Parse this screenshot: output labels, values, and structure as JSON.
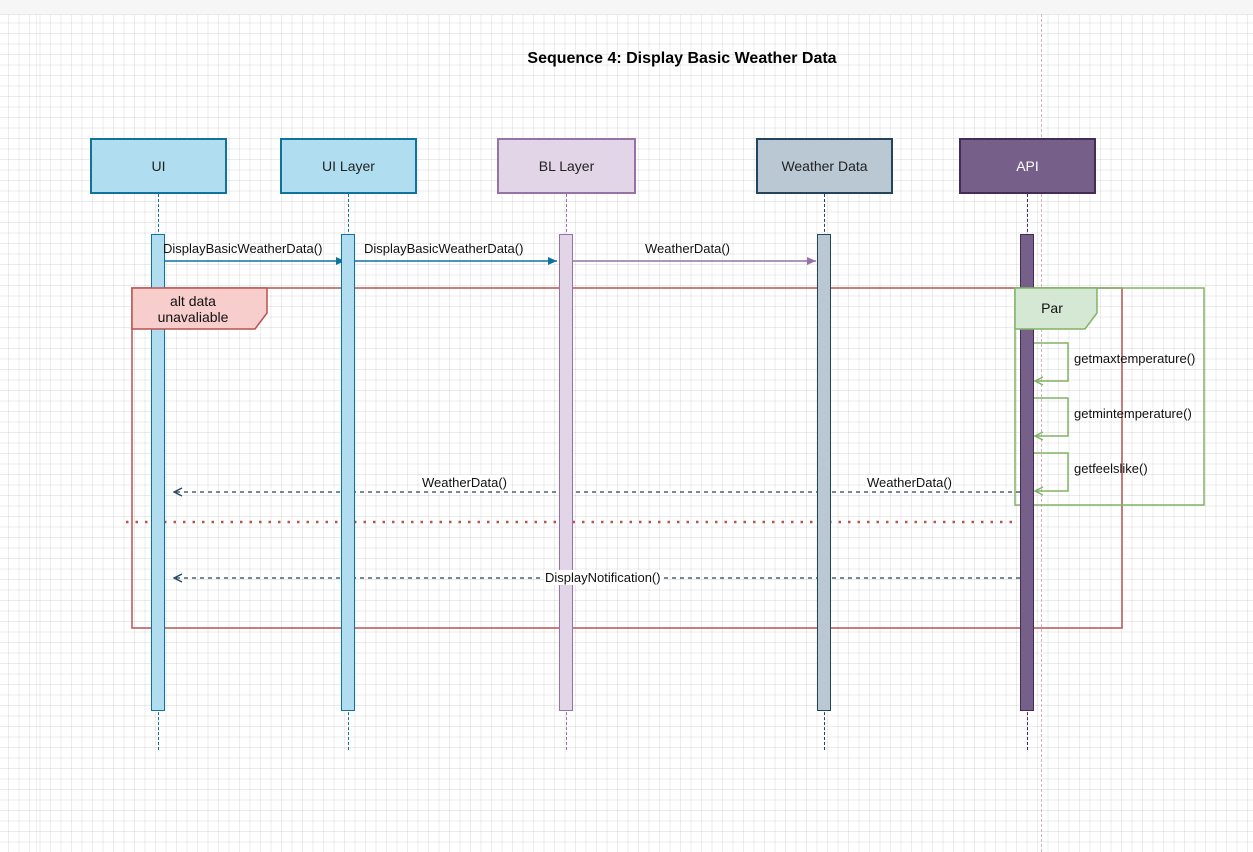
{
  "title": "Sequence 4: Display Basic Weather Data",
  "participants": [
    {
      "id": "ui",
      "label": "UI",
      "fill": "#b1ddf0",
      "stroke": "#10739e"
    },
    {
      "id": "ui-layer",
      "label": "UI Layer",
      "fill": "#b1ddf0",
      "stroke": "#10739e"
    },
    {
      "id": "bl-layer",
      "label": "BL Layer",
      "fill": "#e1d5e7",
      "stroke": "#9673a6"
    },
    {
      "id": "weather-data",
      "label": "Weather Data",
      "fill": "#bac8d3",
      "stroke": "#23445d"
    },
    {
      "id": "api",
      "label": "API",
      "fill": "#76608a",
      "stroke": "#432d57",
      "text_color": "#ffffff"
    }
  ],
  "messages": [
    {
      "from": "ui",
      "to": "ui-layer",
      "label": "DisplayBasicWeatherData()",
      "style": "solid"
    },
    {
      "from": "ui-layer",
      "to": "bl-layer",
      "label": "DisplayBasicWeatherData()",
      "style": "solid"
    },
    {
      "from": "bl-layer",
      "to": "weather-data",
      "label": "WeatherData()",
      "style": "solid"
    },
    {
      "from": "api",
      "to": "api",
      "label": "getmaxtemperature()",
      "style": "self"
    },
    {
      "from": "api",
      "to": "api",
      "label": "getmintemperature()",
      "style": "self"
    },
    {
      "from": "api",
      "to": "api",
      "label": "getfeelslike()",
      "style": "self"
    },
    {
      "from": "api",
      "to": "ui",
      "labels": [
        "WeatherData()",
        "WeatherData()"
      ],
      "style": "dashed"
    },
    {
      "from": "api",
      "to": "ui",
      "label": "DisplayNotification()",
      "style": "dashed"
    }
  ],
  "fragments": {
    "alt": {
      "label": "alt data\nunavaliable",
      "fill": "#f8cecc",
      "stroke": "#b85450"
    },
    "par": {
      "label": "Par",
      "fill": "#d5e8d4",
      "stroke": "#82b366"
    }
  },
  "colors": {
    "blue_arrow": "#10739e",
    "purple_arrow": "#9673a6",
    "return_arrow": "#23445d",
    "self_arrow": "#82b366",
    "separator": "#b85450"
  }
}
